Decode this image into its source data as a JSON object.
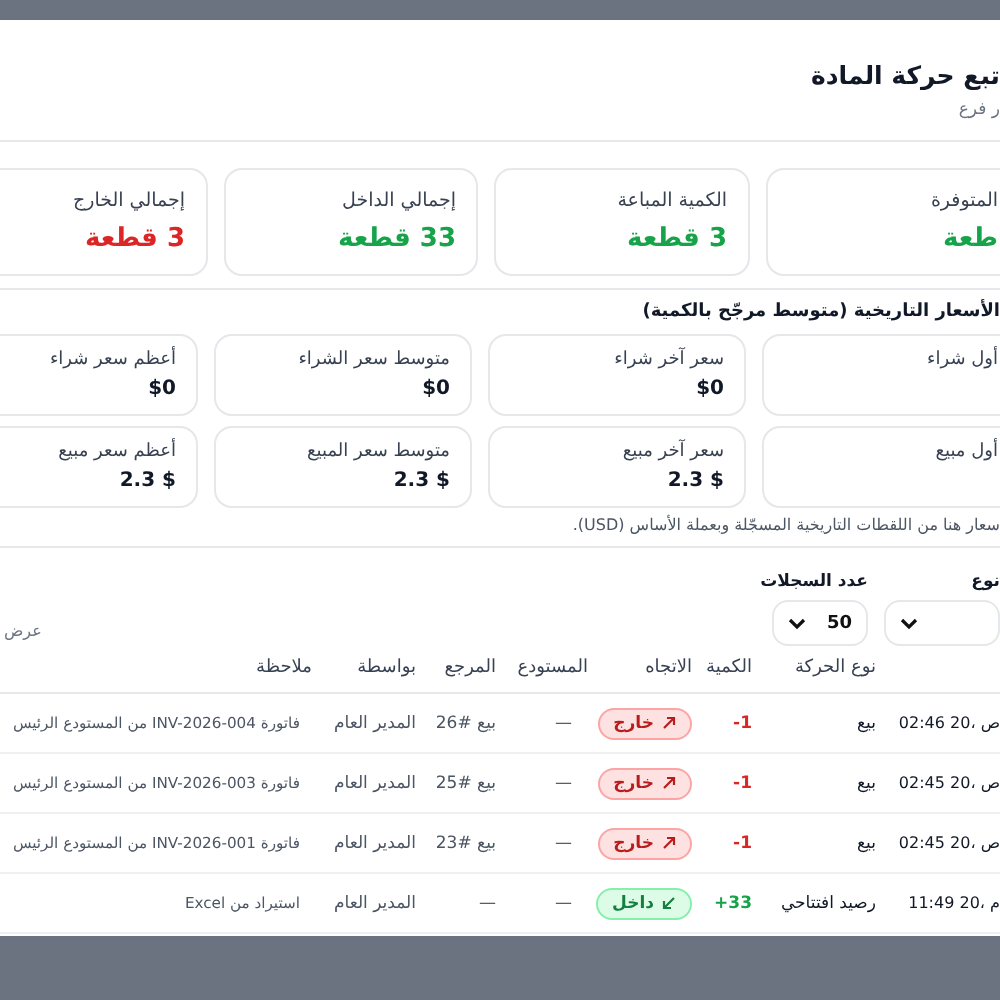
{
  "dialog": {
    "title": "تبع حركة المادة",
    "subtitle": "ر فرع"
  },
  "stats": [
    {
      "label": "المتوفرة",
      "value": "طعة",
      "color": "#16a34a"
    },
    {
      "label": "الكمية المباعة",
      "value": "3 قطعة",
      "color": "#16a34a"
    },
    {
      "label": "إجمالي الداخل",
      "value": "33 قطعة",
      "color": "#16a34a"
    },
    {
      "label": "إجمالي الخارج",
      "value": "3 قطعة",
      "color": "#dc2626"
    }
  ],
  "prices": {
    "title": "الأسعار التاريخية (متوسط مرجّح بالكمية)",
    "rows": [
      [
        {
          "label": "أول شراء"
        },
        {
          "label": "سعر آخر شراء",
          "value": "$0"
        },
        {
          "label": "متوسط سعر الشراء",
          "value": "$0"
        },
        {
          "label": "أعظم سعر شراء",
          "value": "$0"
        }
      ],
      [
        {
          "label": "أول مبيع"
        },
        {
          "label": "سعر آخر مبيع",
          "value": "$ 2.3"
        },
        {
          "label": "متوسط سعر المبيع",
          "value": "$ 2.3"
        },
        {
          "label": "أعظم سعر مبيع",
          "value": "$ 2.3"
        }
      ]
    ],
    "note": "سعار هنا من اللقطات التاريخية المسجّلة وبعملة الأساس (USD)."
  },
  "filters": [
    {
      "label": "نوع"
    },
    {
      "label": "عدد السجلات",
      "value": "50"
    }
  ],
  "show_label": "عرض",
  "table": {
    "columns": [
      "نوع الحركة",
      "الكمية",
      "الاتجاه",
      "المستودع",
      "المرجع",
      "بواسطة",
      "ملاحظة"
    ],
    "rows": [
      {
        "time": "02:46 ص ،20",
        "type": "بيع",
        "quantity": "-1",
        "direction": {
          "label": "خارج",
          "kind": "out"
        },
        "warehouse": "—",
        "reference": "بيع #26",
        "by": "المدير العام",
        "note": "فاتورة INV-2026-004 من المستودع الرئيس"
      },
      {
        "time": "02:45 ص ،20",
        "type": "بيع",
        "quantity": "-1",
        "direction": {
          "label": "خارج",
          "kind": "out"
        },
        "warehouse": "—",
        "reference": "بيع #25",
        "by": "المدير العام",
        "note": "فاتورة INV-2026-003 من المستودع الرئيس"
      },
      {
        "time": "02:45 ص ،20",
        "type": "بيع",
        "quantity": "-1",
        "direction": {
          "label": "خارج",
          "kind": "out"
        },
        "warehouse": "—",
        "reference": "بيع #23",
        "by": "المدير العام",
        "note": "فاتورة INV-2026-001 من المستودع الرئيس"
      },
      {
        "time": "11:49 م ،20",
        "type": "رصيد افتتاحي",
        "quantity": "+33",
        "direction": {
          "label": "داخل",
          "kind": "in"
        },
        "warehouse": "—",
        "reference": "—",
        "by": "المدير العام",
        "note": "استيراد من Excel"
      }
    ]
  }
}
